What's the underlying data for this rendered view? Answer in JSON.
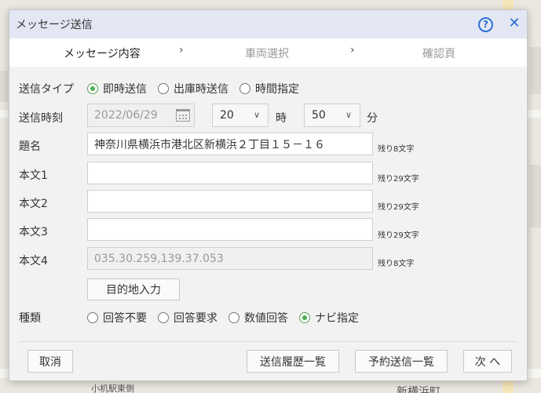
{
  "dialog": {
    "title": "メッセージ送信",
    "help": "?",
    "close": "✕"
  },
  "steps": [
    {
      "label": "メッセージ内容"
    },
    {
      "label": "車両選択"
    },
    {
      "label": "確認頁"
    }
  ],
  "step_separator": "›",
  "send_type": {
    "label": "送信タイプ",
    "options": [
      {
        "label": "即時送信",
        "selected": true
      },
      {
        "label": "出庫時送信",
        "selected": false
      },
      {
        "label": "時間指定",
        "selected": false
      }
    ]
  },
  "send_time": {
    "label": "送信時刻",
    "date": "2022/06/29",
    "hour": "20",
    "hour_unit": "時",
    "minute": "50",
    "minute_unit": "分"
  },
  "subject": {
    "label": "題名",
    "value": "神奈川県横浜市港北区新横浜２丁目１５－１６",
    "remain": "残り8文字"
  },
  "body1": {
    "label": "本文1",
    "value": "",
    "remain": "残り29文字"
  },
  "body2": {
    "label": "本文2",
    "value": "",
    "remain": "残り29文字"
  },
  "body3": {
    "label": "本文3",
    "value": "",
    "remain": "残り29文字"
  },
  "body4": {
    "label": "本文4",
    "value": "035.30.259,139.37.053",
    "remain": "残り8文字"
  },
  "destination_button": "目的地入力",
  "kind": {
    "label": "種類",
    "options": [
      {
        "label": "回答不要",
        "selected": false
      },
      {
        "label": "回答要求",
        "selected": false
      },
      {
        "label": "数値回答",
        "selected": false
      },
      {
        "label": "ナビ指定",
        "selected": true
      }
    ]
  },
  "footer": {
    "cancel": "取消",
    "history": "送信履歴一覧",
    "scheduled": "予約送信一覧",
    "next": "次 へ"
  },
  "map_labels": {
    "station": "小机駅東側",
    "area": "新横浜町"
  },
  "colors": {
    "accent": "#2f6fd6",
    "radio_on": "#4caf50",
    "titlebar": "#e3e7f3"
  }
}
